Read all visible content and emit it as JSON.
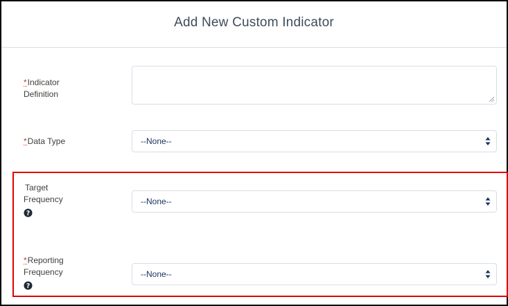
{
  "dialog": {
    "title": "Add New Custom Indicator"
  },
  "fields": {
    "indicator_definition": {
      "required_mark": "*",
      "label_line1": "Indicator",
      "label_line2": "Definition",
      "value": ""
    },
    "data_type": {
      "required_mark": "*",
      "label": "Data Type",
      "selected": "--None--"
    },
    "target_frequency": {
      "label_line1": "Target",
      "label_line2": "Frequency",
      "selected": "--None--",
      "help_icon": "question-circle-icon"
    },
    "reporting_frequency": {
      "required_mark": "*",
      "label_line1": "Reporting",
      "label_line2": "Frequency",
      "selected": "--None--",
      "help_icon": "question-circle-icon"
    }
  },
  "colors": {
    "required": "#c23934",
    "highlight": "#e00000",
    "border": "#d8dde6",
    "value_text": "#16325c"
  }
}
